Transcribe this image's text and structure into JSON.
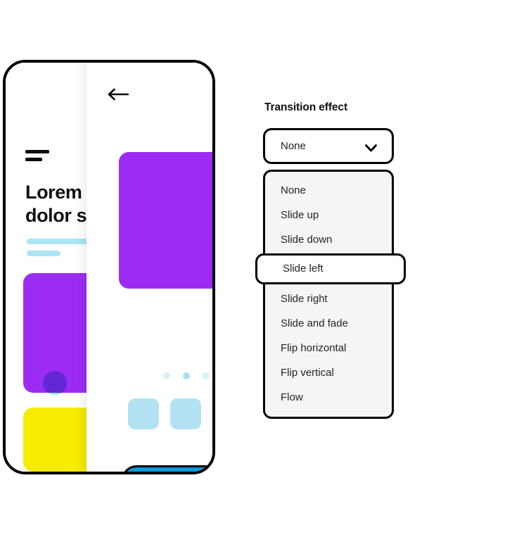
{
  "phone_preview": {
    "back_screen": {
      "menu_icon": "hamburger-icon",
      "heading_line1": "Lorem",
      "heading_line2": "dolor s",
      "bookmark_icon": "bookmark-icon",
      "list_icon": "list-icon"
    },
    "front_screen": {
      "back_icon": "arrow-left-icon",
      "pager_dots": 3,
      "active_dot_index": 2,
      "tiles": 3,
      "cta_icon": "cta-bar"
    },
    "colors": {
      "purple": "#9C2CF3",
      "yellow": "#F5EC00",
      "cyan": "#9FE0E0",
      "light_blue": "#ACE5F5",
      "tile_blue": "#B3E2F2",
      "cta_blue": "#0B99DD",
      "frame": "#000000"
    }
  },
  "panel": {
    "title": "Transition effect",
    "select": {
      "value": "None",
      "chevron_icon": "chevron-down-icon"
    },
    "options": [
      {
        "label": "None",
        "selected": false
      },
      {
        "label": "Slide up",
        "selected": false
      },
      {
        "label": "Slide down",
        "selected": false
      },
      {
        "label": "Slide left",
        "selected": true
      },
      {
        "label": "Slide right",
        "selected": false
      },
      {
        "label": "Slide and fade",
        "selected": false
      },
      {
        "label": "Flip horizontal",
        "selected": false
      },
      {
        "label": "Flip vertical",
        "selected": false
      },
      {
        "label": "Flow",
        "selected": false
      }
    ],
    "colors": {
      "menu_background": "#F4F6F6",
      "selected_background": "#FFFFFF",
      "border": "#000000",
      "text": "#232323"
    }
  }
}
